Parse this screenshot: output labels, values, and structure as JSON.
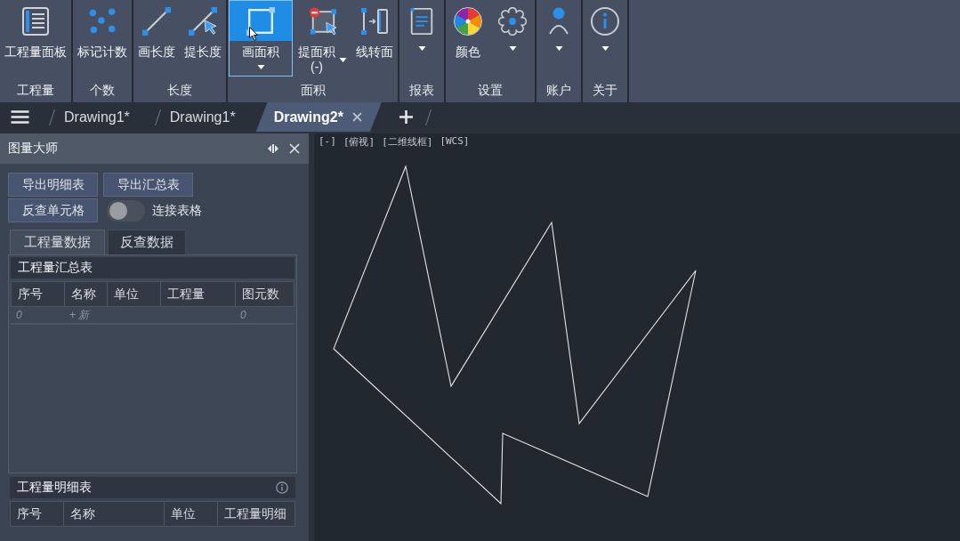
{
  "ribbon": {
    "groups": [
      {
        "label": "工程量",
        "tools": [
          {
            "label": "工程量面板",
            "selected": false,
            "dropdown": false
          }
        ]
      },
      {
        "label": "个数",
        "tools": [
          {
            "label": "标记计数",
            "selected": false,
            "dropdown": false
          }
        ]
      },
      {
        "label": "长度",
        "tools": [
          {
            "label": "画长度",
            "selected": false,
            "dropdown": false
          },
          {
            "label": "提长度",
            "selected": false,
            "dropdown": false
          }
        ]
      },
      {
        "label": "面积",
        "tools": [
          {
            "label": "画面积",
            "selected": true,
            "dropdown": true
          },
          {
            "label": "提面积",
            "note": "(-)",
            "selected": false,
            "dropdown": true
          },
          {
            "label": "线转面",
            "selected": false,
            "dropdown": false
          }
        ]
      },
      {
        "label": "报表",
        "tools": [
          {
            "selected": false,
            "dropdown": true
          }
        ]
      },
      {
        "label": "设置",
        "tools": [
          {
            "label": "颜色",
            "selected": false,
            "dropdown": false
          },
          {
            "selected": false,
            "dropdown": true
          }
        ]
      },
      {
        "label": "账户",
        "tools": [
          {
            "selected": false,
            "dropdown": true
          }
        ]
      },
      {
        "label": "关于",
        "tools": [
          {
            "selected": false,
            "dropdown": true
          }
        ]
      }
    ]
  },
  "document_tabs": {
    "tabs": [
      {
        "label": "Drawing1*",
        "selected": false
      },
      {
        "label": "Drawing1*",
        "selected": false
      },
      {
        "label": "Drawing2*",
        "selected": true
      }
    ]
  },
  "panel": {
    "title": "图量大师",
    "buttons": [
      "导出明细表",
      "导出汇总表",
      "反查单元格"
    ],
    "toggle": {
      "label": "连接表格",
      "on": false
    },
    "tabs": [
      {
        "label": "工程量数据",
        "selected": true
      },
      {
        "label": "反查数据",
        "selected": false
      }
    ],
    "summary": {
      "title": "工程量汇总表",
      "columns": [
        "序号",
        "名称",
        "单位",
        "工程量",
        "图元数"
      ],
      "rows": [
        {
          "number": "0",
          "name": "+ 新",
          "element_count": "0"
        }
      ]
    },
    "detail": {
      "title": "工程量明细表",
      "columns": [
        "序号",
        "名称",
        "单位",
        "工程量明细"
      ]
    }
  },
  "viewport": {
    "view_controls": [
      "[-]",
      "[俯视]",
      "[二维线框]",
      "[WCS]"
    ]
  }
}
